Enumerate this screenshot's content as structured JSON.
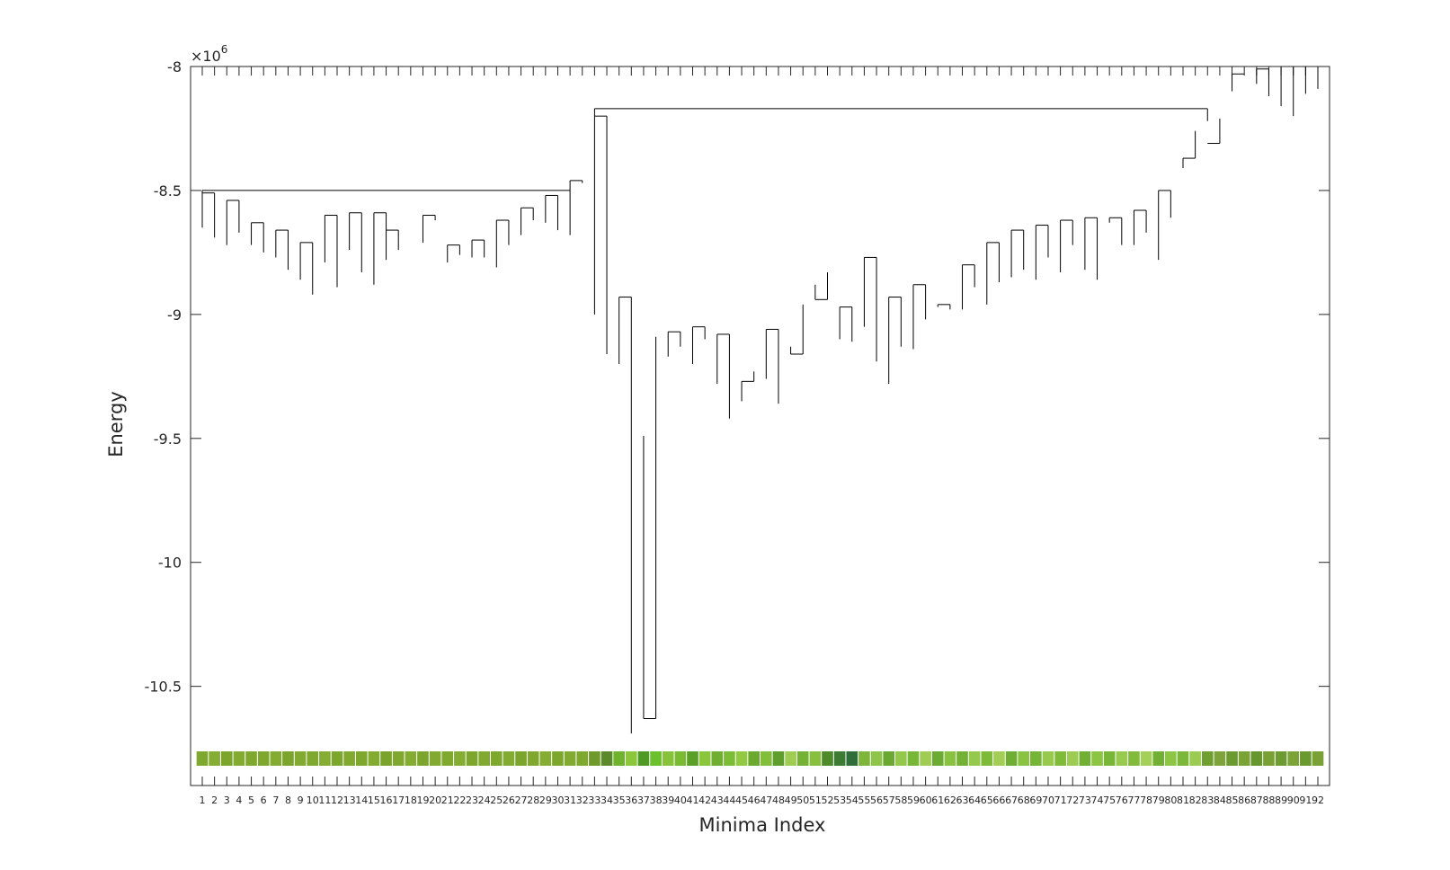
{
  "chart_data": {
    "type": "dendrogram",
    "xlabel": "Minima Index",
    "ylabel": "Energy",
    "y_exponent_label": "×10",
    "y_exponent_power": "6",
    "ylim": [
      -10.9,
      -8.0
    ],
    "yticks": [
      -8,
      -8.5,
      -9,
      -9.5,
      -10,
      -10.5
    ],
    "ytick_labels": [
      "-8",
      "-8.5",
      "-9",
      "-9.5",
      "-10",
      "-10.5"
    ],
    "minima_count": 92,
    "xtick_labels": [
      "1",
      "2",
      "3",
      "4",
      "5",
      "6",
      "7",
      "8",
      "9",
      "10",
      "11",
      "12",
      "13",
      "14",
      "15",
      "16",
      "17",
      "18",
      "19",
      "20",
      "21",
      "22",
      "23",
      "24",
      "25",
      "26",
      "27",
      "28",
      "29",
      "30",
      "31",
      "32",
      "33",
      "34",
      "35",
      "36",
      "37",
      "38",
      "39",
      "40",
      "41",
      "42",
      "43",
      "44",
      "45",
      "46",
      "47",
      "48",
      "49",
      "50",
      "51",
      "52",
      "53",
      "54",
      "55",
      "56",
      "57",
      "58",
      "59",
      "60",
      "61",
      "62",
      "63",
      "64",
      "65",
      "66",
      "67",
      "68",
      "69",
      "70",
      "71",
      "72",
      "73",
      "74",
      "75",
      "76",
      "77",
      "78",
      "79",
      "80",
      "81",
      "82",
      "83",
      "84",
      "85",
      "86",
      "87",
      "88",
      "89",
      "90",
      "91",
      "92"
    ],
    "thumbnail_colors": [
      "#7fa82e",
      "#86ad33",
      "#7ba52c",
      "#83ab31",
      "#80a82f",
      "#7ea72d",
      "#84ac32",
      "#7aa42b",
      "#82aa30",
      "#7fa82e",
      "#85ad33",
      "#7ca62c",
      "#81a930",
      "#7ea72d",
      "#83ab31",
      "#79a32b",
      "#80a82f",
      "#84ac32",
      "#7ba52c",
      "#82aa30",
      "#7fa82e",
      "#86ad33",
      "#7da62d",
      "#81a930",
      "#7ea72d",
      "#83ab31",
      "#7aa42b",
      "#80a82f",
      "#85ad33",
      "#7ca62c",
      "#82aa30",
      "#7fa82e",
      "#6f9a2a",
      "#5c8a2a",
      "#6fb22e",
      "#8cc63a",
      "#4f9a24",
      "#6cc02e",
      "#86c23a",
      "#7bbb34",
      "#5aa028",
      "#8bc53c",
      "#6fae30",
      "#7cbc36",
      "#93c843",
      "#6aa82e",
      "#82be3a",
      "#5f9e2c",
      "#9fcc52",
      "#73b234",
      "#88c03e",
      "#4e8a2a",
      "#3d7a34",
      "#2f6e3a",
      "#7db63a",
      "#8fc44a",
      "#6aa832",
      "#94c84c",
      "#78b638",
      "#a0cc55",
      "#6cab33",
      "#89c240",
      "#73b035",
      "#95c94d",
      "#7eb93a",
      "#a2ce57",
      "#6fae33",
      "#8ac341",
      "#76b437",
      "#97c94e",
      "#80ba3b",
      "#9ecb53",
      "#70af34",
      "#8cc443",
      "#79b638",
      "#99ca50",
      "#82bb3c",
      "#a4cf59",
      "#72b035",
      "#8ec545",
      "#7bb739",
      "#9bcb51",
      "#6e9f2f",
      "#7ea33a",
      "#6b9a30",
      "#7aa236",
      "#66962e",
      "#78a034",
      "#6e9b31",
      "#7ba337",
      "#6a992f",
      "#79a135"
    ],
    "leaves": [
      [
        1,
        -8.65
      ],
      [
        2,
        -8.69
      ],
      [
        3,
        -8.72
      ],
      [
        4,
        -8.67
      ],
      [
        5,
        -8.72
      ],
      [
        6,
        -8.75
      ],
      [
        7,
        -8.77
      ],
      [
        8,
        -8.82
      ],
      [
        9,
        -8.86
      ],
      [
        10,
        -8.92
      ],
      [
        11,
        -8.79
      ],
      [
        12,
        -8.89
      ],
      [
        13,
        -8.74
      ],
      [
        14,
        -8.83
      ],
      [
        15,
        -8.88
      ],
      [
        16,
        -8.78
      ],
      [
        17,
        -8.74
      ],
      [
        18,
        -8.76
      ],
      [
        19,
        -8.71
      ],
      [
        20,
        -8.62
      ],
      [
        21,
        -8.79
      ],
      [
        22,
        -8.76
      ],
      [
        23,
        -8.77
      ],
      [
        24,
        -8.77
      ],
      [
        25,
        -8.81
      ],
      [
        26,
        -8.72
      ],
      [
        27,
        -8.68
      ],
      [
        28,
        -8.62
      ],
      [
        29,
        -8.63
      ],
      [
        30,
        -8.66
      ],
      [
        31,
        -8.68
      ],
      [
        32,
        -8.47
      ],
      [
        33,
        -9.0
      ],
      [
        34,
        -9.16
      ],
      [
        35,
        -9.2
      ],
      [
        36,
        -10.69
      ],
      [
        37,
        -9.49
      ],
      [
        38,
        -9.09
      ],
      [
        39,
        -9.17
      ],
      [
        40,
        -9.13
      ],
      [
        41,
        -9.2
      ],
      [
        42,
        -9.1
      ],
      [
        43,
        -9.28
      ],
      [
        44,
        -9.42
      ],
      [
        45,
        -9.35
      ],
      [
        46,
        -9.23
      ],
      [
        47,
        -9.26
      ],
      [
        48,
        -9.36
      ],
      [
        49,
        -9.13
      ],
      [
        50,
        -8.96
      ],
      [
        51,
        -8.88
      ],
      [
        52,
        -8.83
      ],
      [
        53,
        -9.1
      ],
      [
        54,
        -9.11
      ],
      [
        55,
        -9.05
      ],
      [
        56,
        -9.19
      ],
      [
        57,
        -9.28
      ],
      [
        58,
        -9.13
      ],
      [
        59,
        -9.14
      ],
      [
        60,
        -9.02
      ],
      [
        61,
        -8.97
      ],
      [
        62,
        -8.98
      ],
      [
        63,
        -8.98
      ],
      [
        64,
        -8.89
      ],
      [
        65,
        -8.96
      ],
      [
        66,
        -8.87
      ],
      [
        67,
        -8.85
      ],
      [
        68,
        -8.82
      ],
      [
        69,
        -8.86
      ],
      [
        70,
        -8.77
      ],
      [
        71,
        -8.83
      ],
      [
        72,
        -8.72
      ],
      [
        73,
        -8.82
      ],
      [
        74,
        -8.86
      ],
      [
        75,
        -8.63
      ],
      [
        76,
        -8.72
      ],
      [
        77,
        -8.72
      ],
      [
        78,
        -8.67
      ],
      [
        79,
        -8.78
      ],
      [
        80,
        -8.61
      ],
      [
        81,
        -8.41
      ],
      [
        82,
        -8.26
      ],
      [
        83,
        -8.22
      ],
      [
        84,
        -8.21
      ],
      [
        85,
        -8.1
      ],
      [
        86,
        -8.03
      ],
      [
        87,
        -8.07
      ],
      [
        88,
        -8.12
      ],
      [
        89,
        -8.16
      ],
      [
        90,
        -8.2
      ],
      [
        91,
        -8.11
      ],
      [
        92,
        -8.09
      ]
    ],
    "merges": [
      [
        1,
        2,
        -8.51
      ],
      [
        3,
        4,
        -8.54
      ],
      [
        5,
        6,
        -8.63
      ],
      [
        9,
        10,
        -8.71
      ],
      [
        7,
        8,
        -8.66
      ],
      [
        13,
        14,
        -8.59
      ],
      [
        16,
        17,
        -8.66
      ],
      [
        15,
        16,
        -8.59
      ],
      [
        11,
        12,
        -8.6
      ],
      [
        19,
        20,
        -8.6
      ],
      [
        21,
        22,
        -8.72
      ],
      [
        23,
        24,
        -8.7
      ],
      [
        25,
        26,
        -8.62
      ],
      [
        27,
        28,
        -8.57
      ],
      [
        29,
        30,
        -8.52
      ],
      [
        31,
        32,
        -8.46
      ],
      [
        1,
        31,
        -8.5
      ],
      [
        33,
        34,
        -8.2
      ],
      [
        35,
        36,
        -8.93
      ],
      [
        37,
        38,
        -10.63
      ],
      [
        39,
        40,
        -9.07
      ],
      [
        41,
        42,
        -9.05
      ],
      [
        43,
        44,
        -9.08
      ],
      [
        45,
        46,
        -9.27
      ],
      [
        47,
        48,
        -9.06
      ],
      [
        49,
        50,
        -9.16
      ],
      [
        51,
        52,
        -8.94
      ],
      [
        53,
        54,
        -8.97
      ],
      [
        55,
        56,
        -8.77
      ],
      [
        57,
        58,
        -8.93
      ],
      [
        59,
        60,
        -8.88
      ],
      [
        61,
        62,
        -8.96
      ],
      [
        63,
        64,
        -8.8
      ],
      [
        65,
        66,
        -8.71
      ],
      [
        67,
        68,
        -8.66
      ],
      [
        69,
        70,
        -8.64
      ],
      [
        71,
        72,
        -8.62
      ],
      [
        73,
        74,
        -8.61
      ],
      [
        75,
        76,
        -8.61
      ],
      [
        77,
        78,
        -8.58
      ],
      [
        79,
        80,
        -8.5
      ],
      [
        81,
        82,
        -8.37
      ],
      [
        83,
        84,
        -8.31
      ],
      [
        85,
        86,
        -8.03
      ],
      [
        87,
        88,
        -8.01
      ],
      [
        89,
        90,
        -8.0
      ],
      [
        91,
        92,
        -8.0
      ],
      [
        33,
        83,
        -8.17
      ]
    ]
  }
}
